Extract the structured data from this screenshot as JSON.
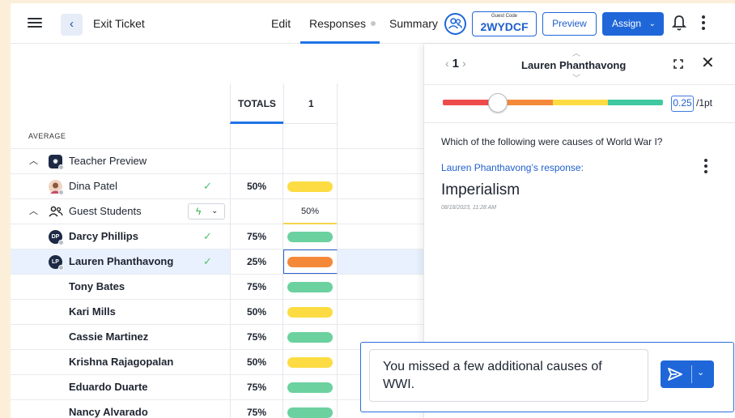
{
  "header": {
    "title": "Exit Ticket",
    "back_icon": "chevron-left-icon",
    "tabs": [
      {
        "label": "Edit"
      },
      {
        "label": "Responses"
      },
      {
        "label": "Summary"
      }
    ],
    "guest_code_label": "Guest Code",
    "guest_code": "2WYDCF",
    "preview_label": "Preview",
    "assign_label": "Assign",
    "accent_color": "#1f67d9"
  },
  "table": {
    "totals_header": "TOTALS",
    "question_header": "1",
    "average_label": "AVERAGE",
    "groups": {
      "teacher": "Teacher Preview",
      "guest": "Guest Students",
      "guest_average": "50%"
    },
    "rows": [
      {
        "name": "Dina Patel",
        "total": "50%",
        "score_color": "yellow",
        "checked": true
      },
      {
        "name": "Darcy Phillips",
        "initials": "DP",
        "total": "75%",
        "score_color": "green",
        "checked": true
      },
      {
        "name": "Lauren Phanthavong",
        "initials": "LP",
        "total": "25%",
        "score_color": "orange",
        "checked": true,
        "selected": true
      },
      {
        "name": "Tony Bates",
        "total": "75%",
        "score_color": "green"
      },
      {
        "name": "Kari Mills",
        "total": "50%",
        "score_color": "yellow"
      },
      {
        "name": "Cassie Martinez",
        "total": "75%",
        "score_color": "green"
      },
      {
        "name": "Krishna Rajagopalan",
        "total": "50%",
        "score_color": "yellow"
      },
      {
        "name": "Eduardo Duarte",
        "total": "75%",
        "score_color": "green"
      },
      {
        "name": "Nancy Alvarado",
        "total": "75%",
        "score_color": "green"
      }
    ]
  },
  "panel": {
    "question_number": "1",
    "student_name": "Lauren Phanthavong",
    "score_value": "0.25",
    "score_max": "/1pt",
    "score_fraction": 0.25,
    "score_colors": [
      "#ee4c4c",
      "#f5893a",
      "#fcdc42",
      "#3fc9a0"
    ],
    "question": "Which of the following were causes of World War I?",
    "response_label": "Lauren Phanthavong’s response:",
    "answer": "Imperialism",
    "timestamp": "08/18/2023, 11:28 AM"
  },
  "feedback": {
    "text": "You missed a few additional causes of WWI."
  }
}
